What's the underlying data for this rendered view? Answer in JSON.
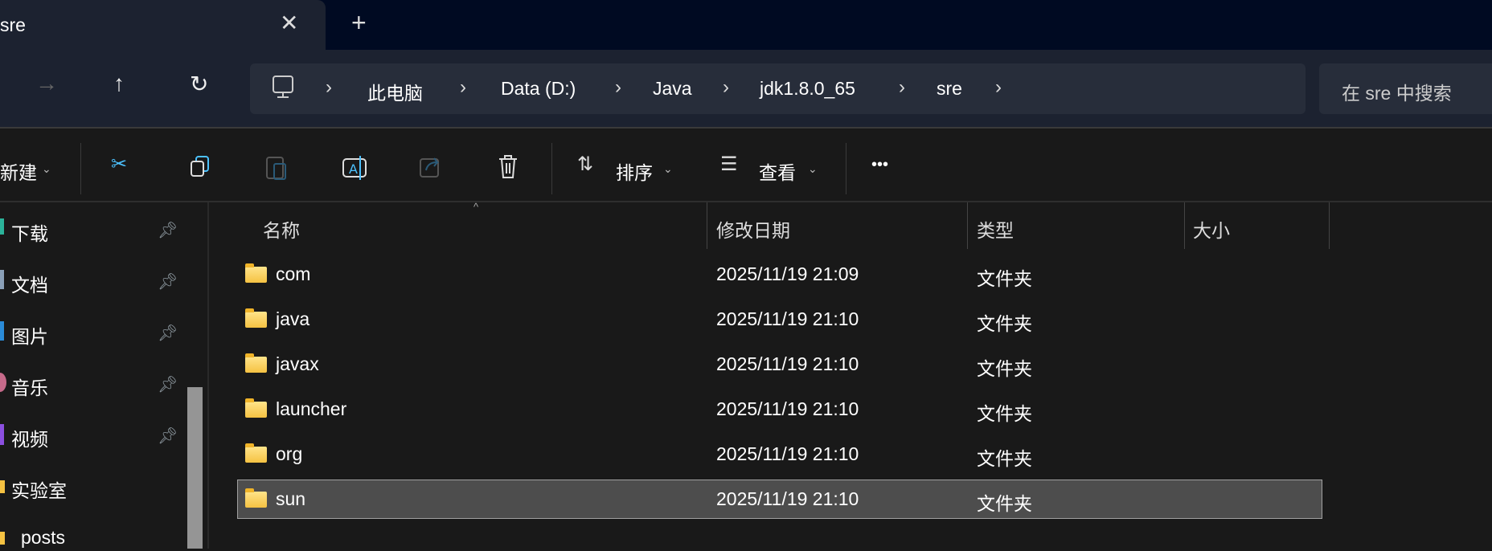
{
  "tab": {
    "title": "sre",
    "close": "✕",
    "new": "+"
  },
  "nav": {
    "forward": "→",
    "up": "↑",
    "refresh": "↻"
  },
  "address": {
    "crumbs": [
      "此电脑",
      "Data (D:)",
      "Java",
      "jdk1.8.0_65",
      "sre"
    ]
  },
  "search": {
    "placeholder": "在 sre 中搜索"
  },
  "toolbar": {
    "new_label": "新建",
    "sort_label": "排序",
    "view_label": "查看",
    "more": "•••"
  },
  "sidebar": {
    "items": [
      {
        "label": "下载",
        "pinned": true
      },
      {
        "label": "文档",
        "pinned": true
      },
      {
        "label": "图片",
        "pinned": true
      },
      {
        "label": "音乐",
        "pinned": true
      },
      {
        "label": "视频",
        "pinned": true
      },
      {
        "label": "实验室",
        "pinned": false
      },
      {
        "label": "posts",
        "pinned": false
      }
    ]
  },
  "columns": {
    "name": "名称",
    "date": "修改日期",
    "type": "类型",
    "size": "大小"
  },
  "files": [
    {
      "name": "com",
      "date": "2025/11/19 21:09",
      "type": "文件夹"
    },
    {
      "name": "java",
      "date": "2025/11/19 21:10",
      "type": "文件夹"
    },
    {
      "name": "javax",
      "date": "2025/11/19 21:10",
      "type": "文件夹"
    },
    {
      "name": "launcher",
      "date": "2025/11/19 21:10",
      "type": "文件夹"
    },
    {
      "name": "org",
      "date": "2025/11/19 21:10",
      "type": "文件夹"
    },
    {
      "name": "sun",
      "date": "2025/11/19 21:10",
      "type": "文件夹",
      "selected": true
    }
  ],
  "colors": {
    "accent": "#4cc2ff",
    "selected_row": "#4d4d4d"
  }
}
